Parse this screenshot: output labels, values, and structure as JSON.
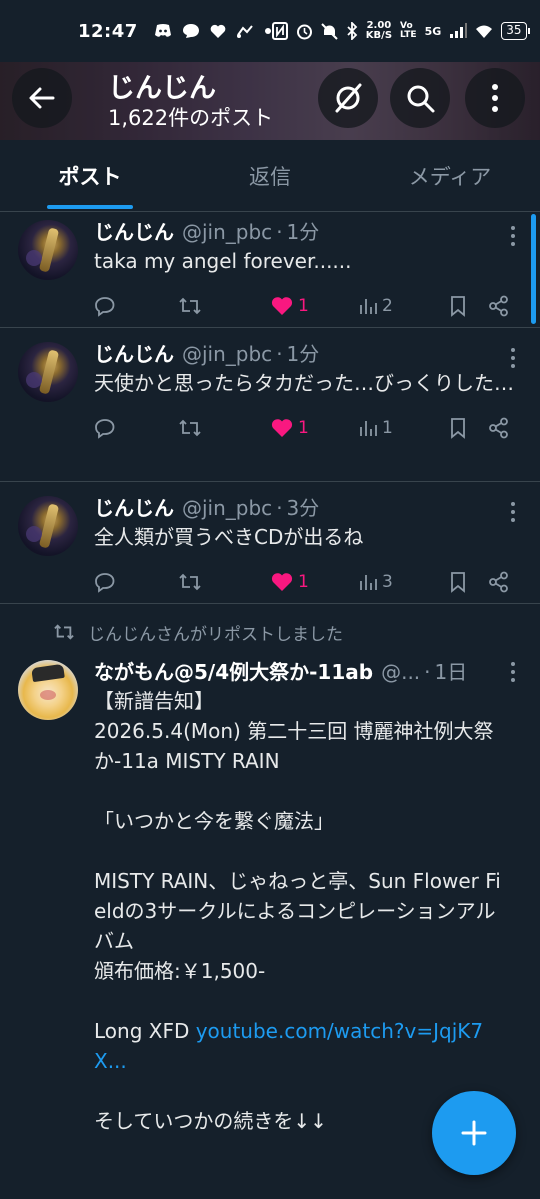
{
  "status_bar": {
    "time": "12:47",
    "left_icons": [
      "discord-icon",
      "chat-bubble-icon",
      "heart-icon",
      "network-icon",
      "dot-icon"
    ],
    "speed": "2.00",
    "speed_unit": "KB/S",
    "network": "5G",
    "battery": "35"
  },
  "header": {
    "name": "じんじん",
    "post_count": "1,622件のポスト"
  },
  "tabs": [
    {
      "label": "ポスト",
      "active": true
    },
    {
      "label": "返信",
      "active": false
    },
    {
      "label": "メディア",
      "active": false
    }
  ],
  "posts": [
    {
      "name": "じんじん",
      "handle": "@jin_pbc",
      "time": "1分",
      "text": "taka my angel forever......",
      "likes": "1",
      "views": "2"
    },
    {
      "name": "じんじん",
      "handle": "@jin_pbc",
      "time": "1分",
      "text": "天使かと思ったらタカだった…びっくりした…",
      "likes": "1",
      "views": "1"
    },
    {
      "name": "じんじん",
      "handle": "@jin_pbc",
      "time": "3分",
      "text": "全人類が買うべきCDが出るね",
      "likes": "1",
      "views": "3"
    }
  ],
  "repost": {
    "label": "じんじんさんがリポストしました",
    "name": "ながもん@5/4例大祭か-11ab",
    "handle": "@...",
    "time": "1日",
    "text_1": "【新譜告知】\n2026.5.4(Mon) 第二十三回 博麗神社例大祭\nか-11a MISTY RAIN\n\n「いつかと今を繋ぐ魔法」\n\nMISTY RAIN、じゃねっと亭、Sun Flower Fieldの3サークルによるコンピレーションアルバム\n頒布価格:￥1,500-\n\nLong XFD ",
    "link": "youtube.com/watch?v=JqjK7X...",
    "text_2": "\n\nそしていつかの続きを↓↓"
  },
  "colors": {
    "background": "#15202b",
    "accent": "#1d9bf0",
    "like": "#f91880",
    "muted": "#8b98a5"
  }
}
